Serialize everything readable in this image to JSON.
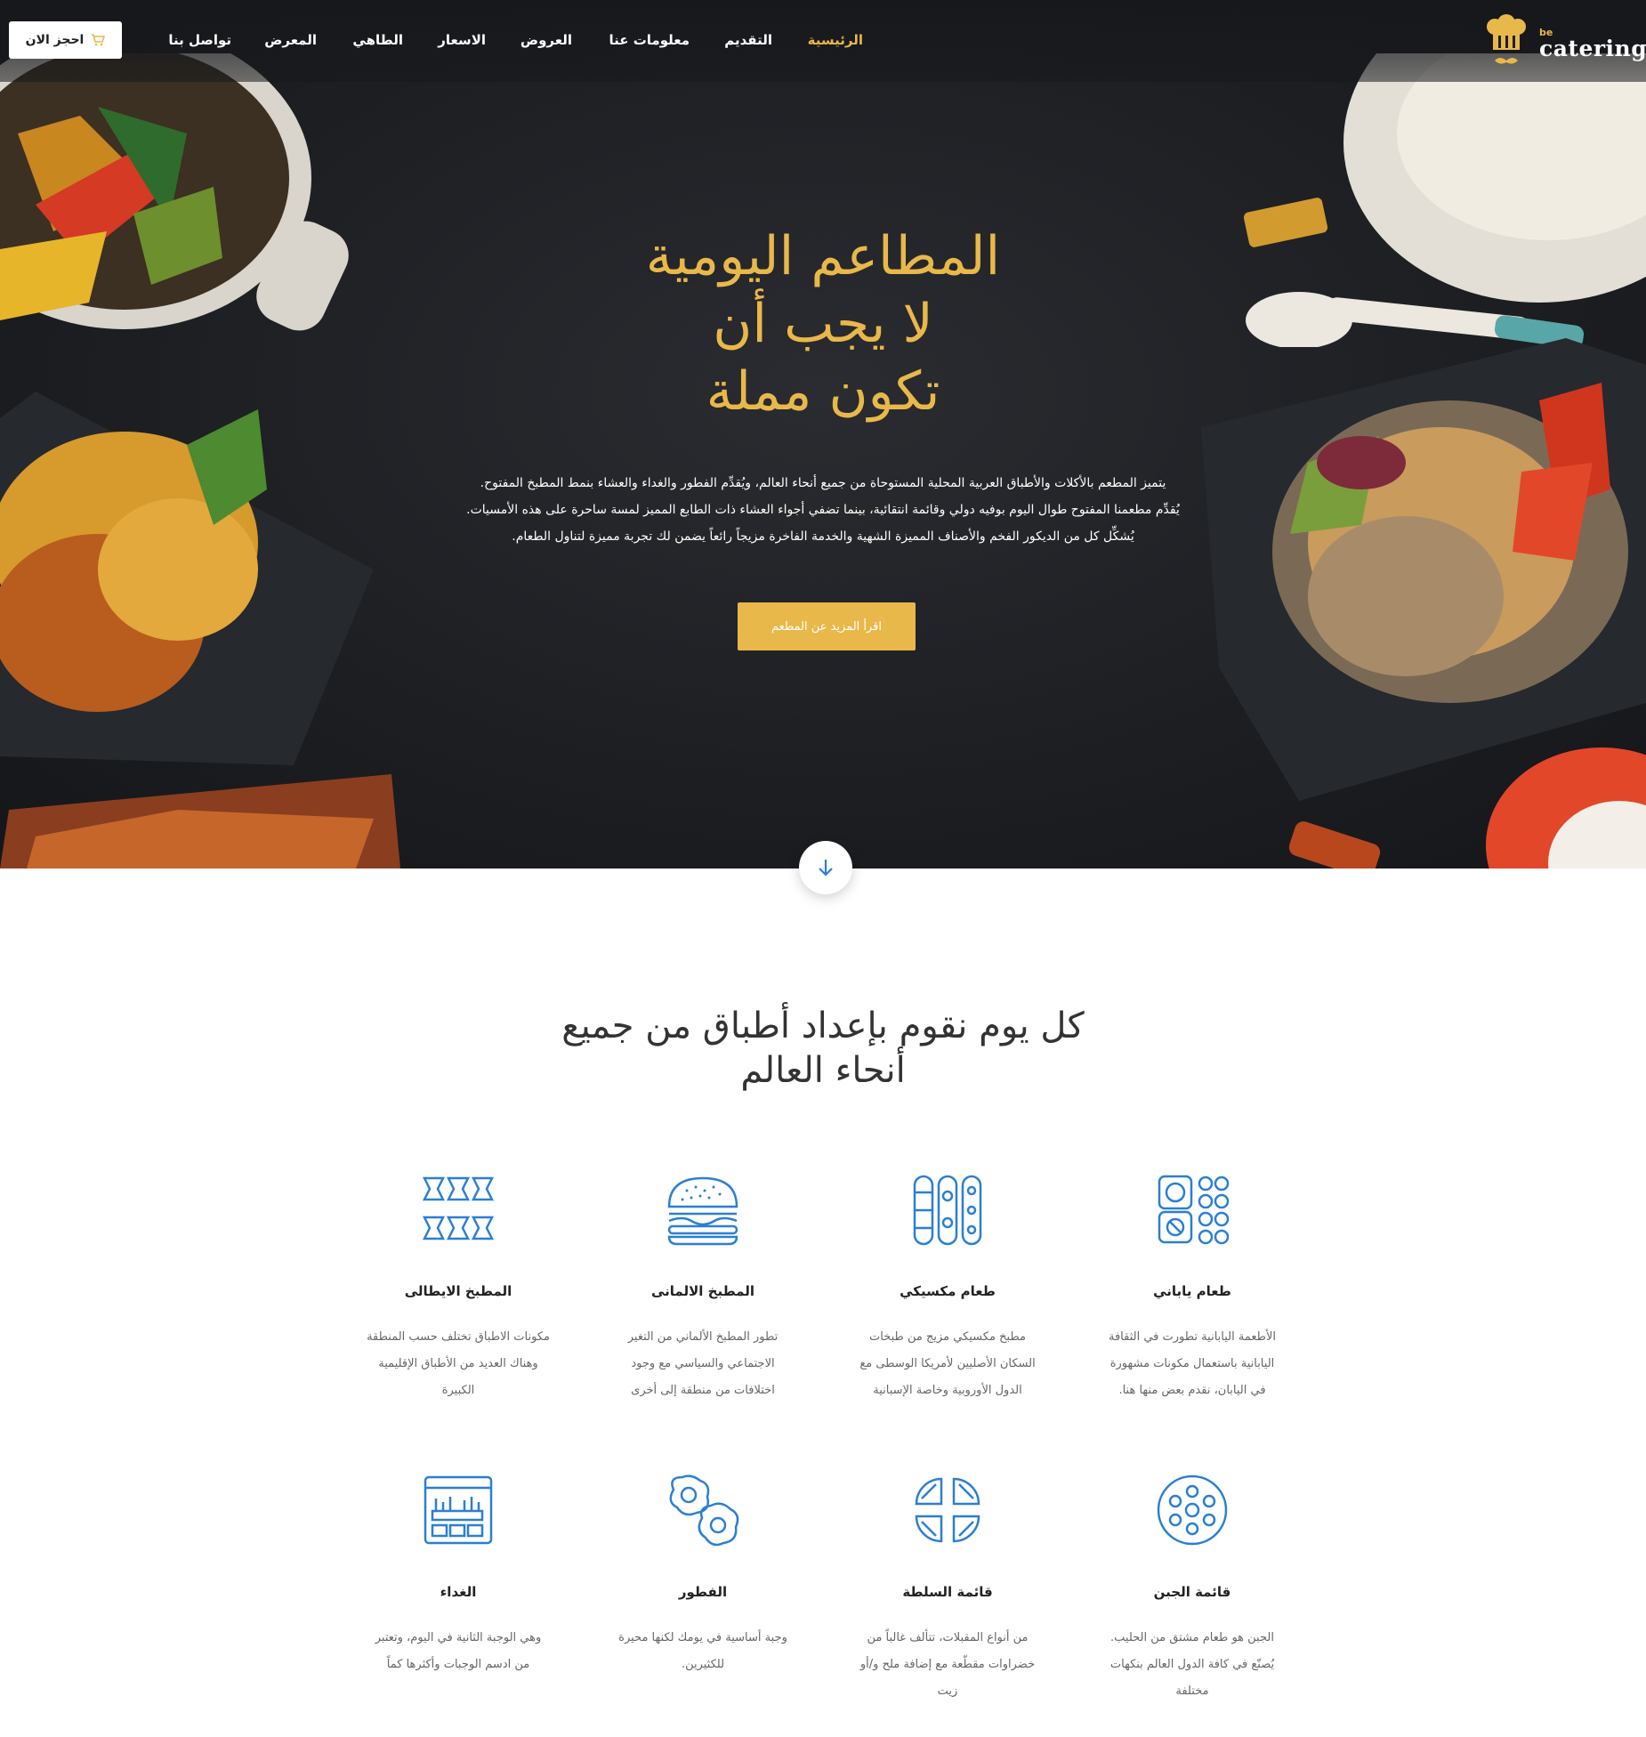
{
  "header": {
    "logo": {
      "small": "be",
      "brand": "catering"
    },
    "nav": [
      {
        "label": "الرئيسية",
        "active": true
      },
      {
        "label": "التقديم"
      },
      {
        "label": "معلومات عنا"
      },
      {
        "label": "العروض"
      },
      {
        "label": "الاسعار"
      },
      {
        "label": "الطاهي"
      },
      {
        "label": "المعرض"
      },
      {
        "label": "تواصل بنا"
      }
    ],
    "book_button": {
      "label": "احجز الان",
      "icon": "cart-icon"
    }
  },
  "hero": {
    "title_lines": [
      "المطاعم اليومية",
      "لا يجب أن",
      "تكون مملة"
    ],
    "text_lines": [
      "يتميز المطعم بالأكلات والأطباق العربية المحلية المستوحاة من جميع أنحاء العالم، ويُقدِّم الفطور والغداء والعشاء بنمط المطبخ المفتوح.",
      "يُقدِّم مطعمنا المفتوح طوال اليوم بوفيه دولي وقائمة انتقائية، بينما تضفي أجواء العشاء ذات الطابع المميز لمسة ساحرة على هذه الأمسيات.",
      "يُشكِّل كل من الديكور الفخم والأصناف المميزة الشهية والخدمة الفاخرة مزيجاً رائعاً يضمن لك تجربة مميزة لتناول الطعام."
    ],
    "read_more": "اقرأ المزيد عن المطعم",
    "scroll_icon": "arrow-down-icon"
  },
  "section": {
    "title_lines": [
      "كل يوم نقوم بإعداد أطباق من جميع",
      "أنحاء العالم"
    ],
    "cards": [
      {
        "icon": "sushi-icon",
        "title": "طعام ياباني",
        "desc": [
          "الأطعمة اليابانية تطورت في الثقافة",
          "اليابانية باستعمال مكونات مشهورة",
          "في اليابان، نقدم بعض منها هنا."
        ]
      },
      {
        "icon": "skewers-icon",
        "title": "طعام مكسيكي",
        "desc": [
          "مطبخ مكسيكي مزيج من طبخات",
          "السكان الأصليين لأمريكا الوسطى مع",
          "الدول الأوروبية وخاصة الإسبانية"
        ]
      },
      {
        "icon": "burger-icon",
        "title": "المطبخ الالمانى",
        "desc": [
          "تطور المطبخ الألماني من التغير",
          "الاجتماعي والسياسي مع وجود",
          "اختلافات من منطقة إلى أخرى"
        ]
      },
      {
        "icon": "pasta-icon",
        "title": "المطبخ الايطالى",
        "desc": [
          "مكونات الاطباق تختلف حسب المنطقة",
          "وهناك العديد من الأطباق الإقليمية",
          "الكبيرة"
        ]
      },
      {
        "icon": "cheese-icon",
        "title": "قائمة الجبن",
        "desc": [
          "الجبن هو طعام مشتق من الحليب.",
          "يُصنّع في كافة الدول العالم بنكهات",
          "مختلفة"
        ]
      },
      {
        "icon": "salad-icon",
        "title": "قائمة السلطة",
        "desc": [
          "من أنواع المقبلات، تتألف غالباً من",
          "خضراوات مقطّعة مع إضافة ملح و/أو",
          "زيت"
        ]
      },
      {
        "icon": "eggs-icon",
        "title": "الفطور",
        "desc": [
          "وجبة أساسية في يومك لكنها محيرة",
          "للكثيرين."
        ]
      },
      {
        "icon": "lunch-box-icon",
        "title": "الغداء",
        "desc": [
          "وهي الوجبة الثانية في اليوم، وتعتبر",
          "من ادسم الوجبات وأكثرها كماً"
        ]
      }
    ]
  },
  "colors": {
    "accent": "#e9b84a",
    "icon_blue": "#2b7fd3",
    "hero_bg": "#1f2125"
  }
}
